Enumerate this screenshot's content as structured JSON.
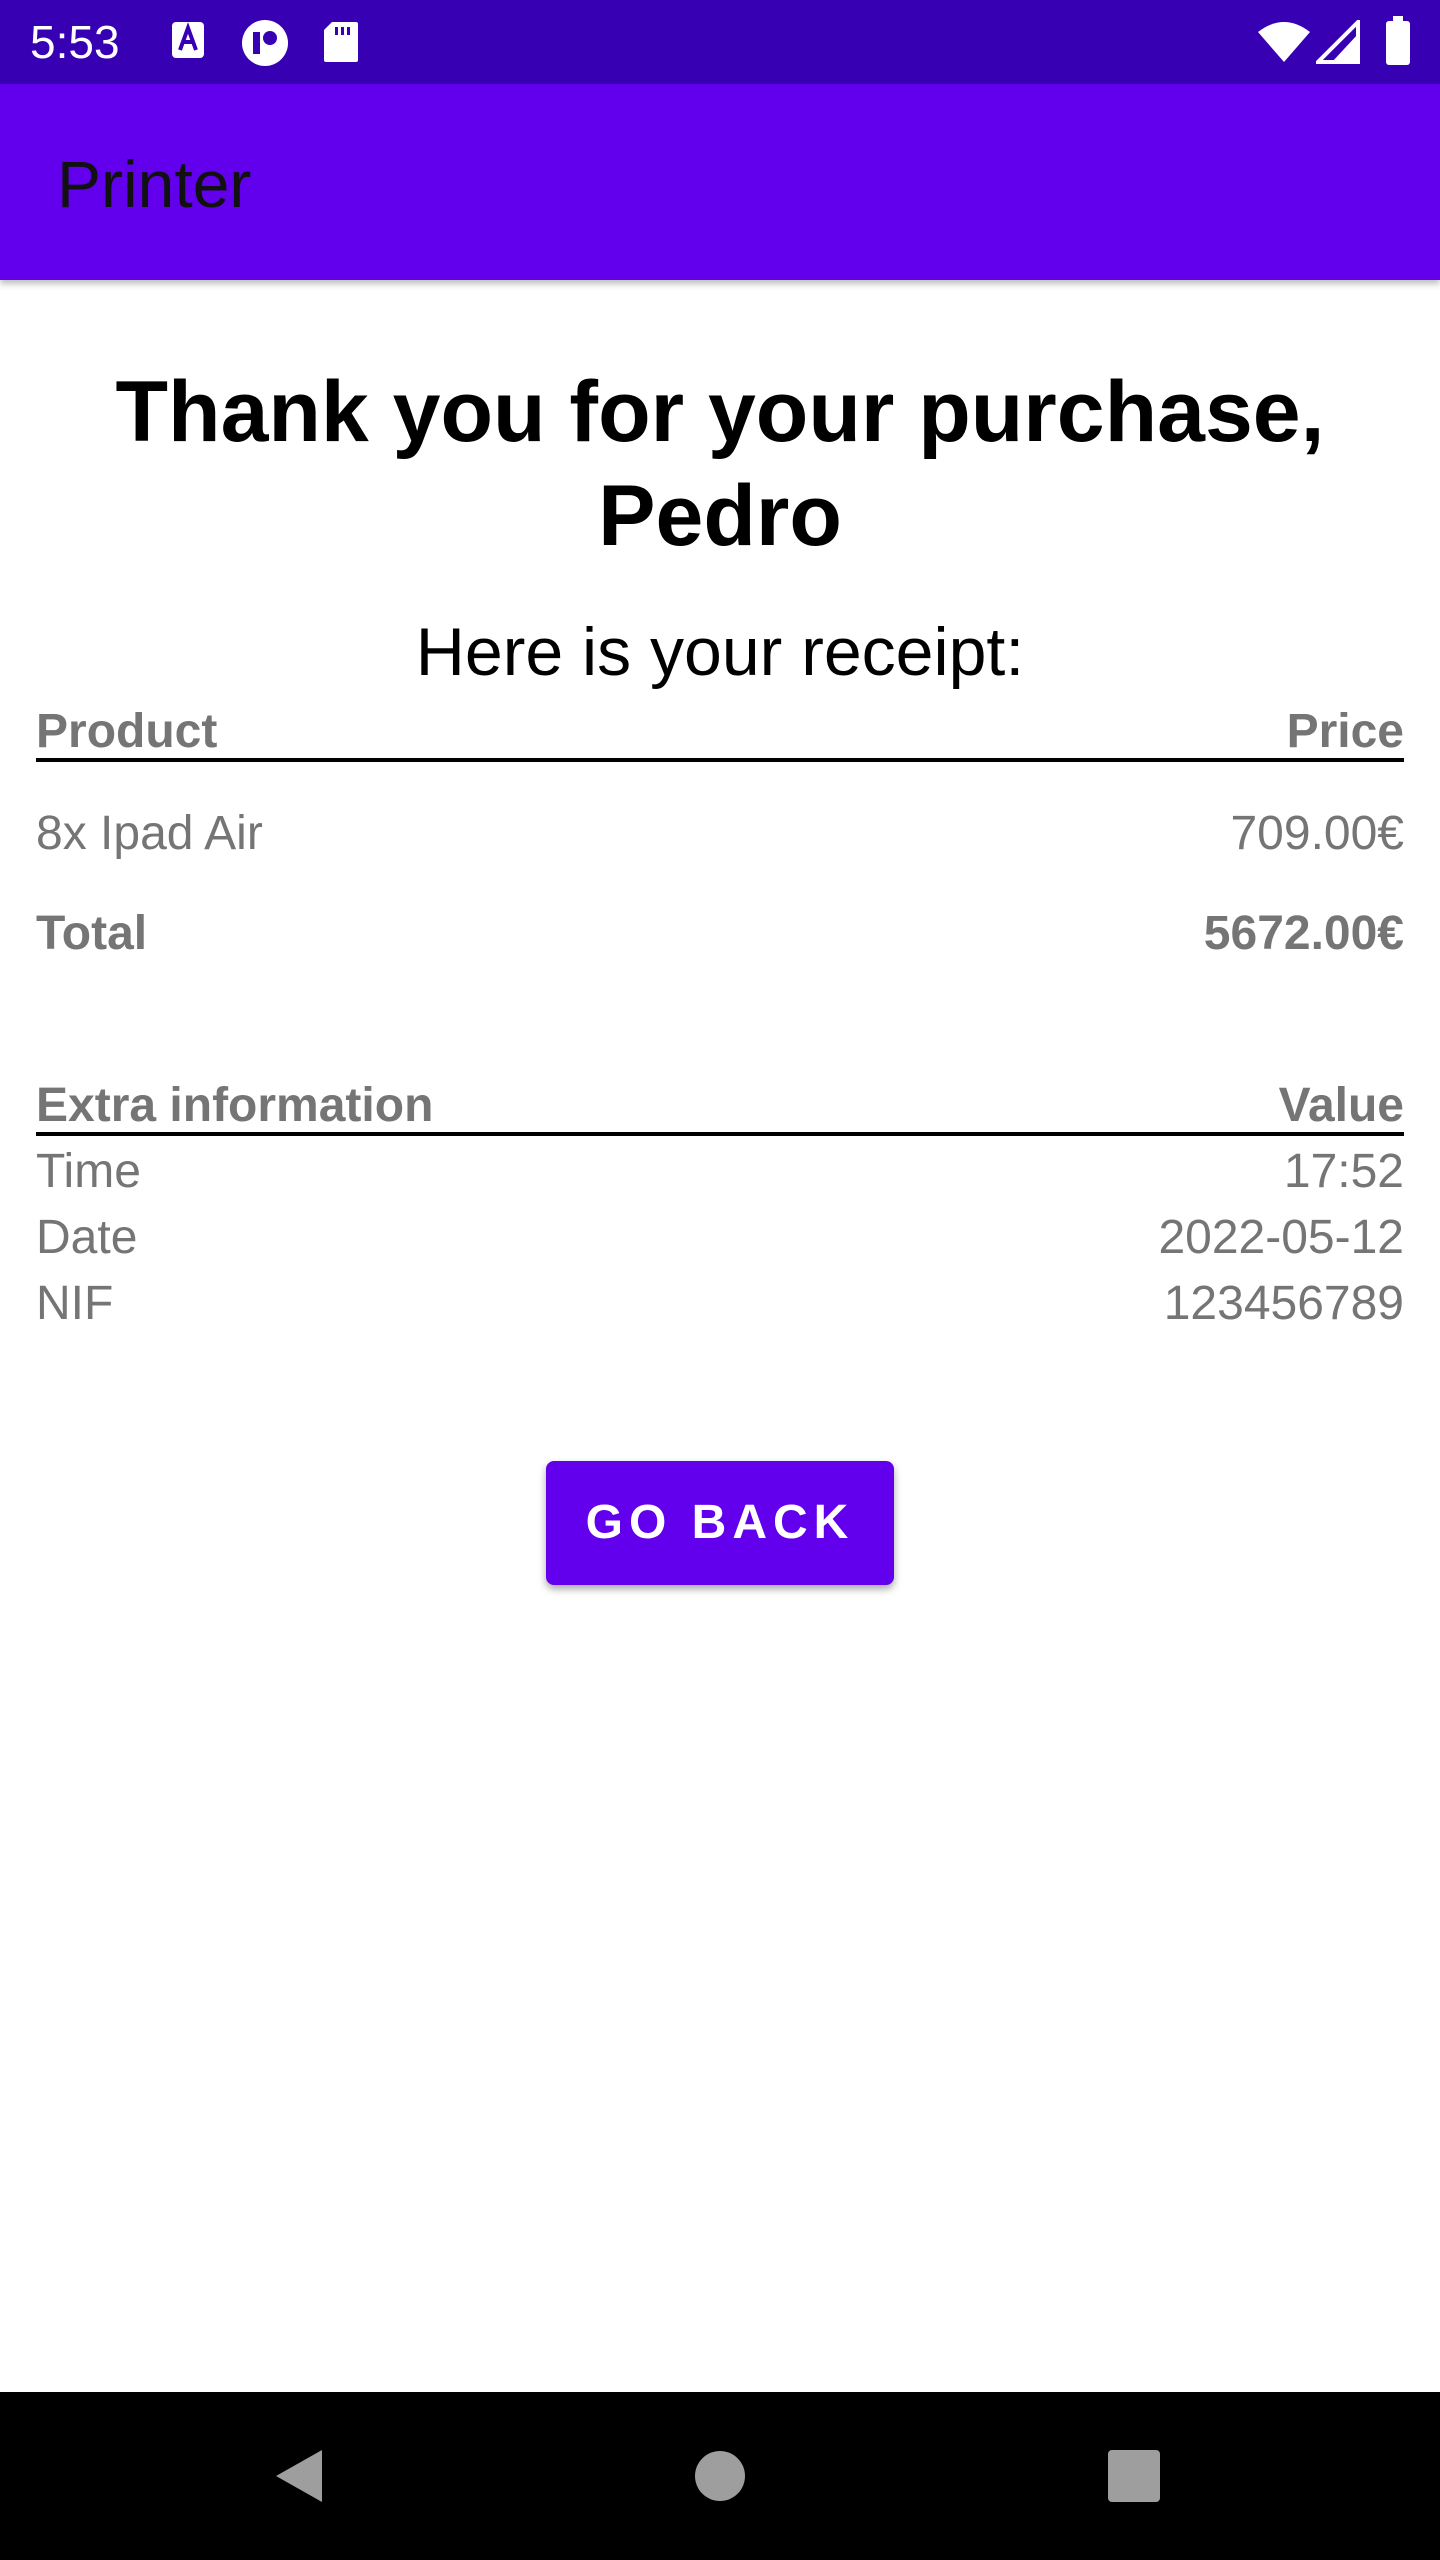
{
  "status_bar": {
    "time": "5:53",
    "icons_left": [
      "text-a-icon",
      "accessibility-icon",
      "sd-card-icon"
    ],
    "icons_right": [
      "wifi-icon",
      "signal-icon",
      "battery-icon"
    ]
  },
  "app_bar": {
    "title": "Printer"
  },
  "receipt": {
    "heading": "Thank you for your purchase, Pedro",
    "subheading": "Here is your receipt:",
    "products": {
      "headers": {
        "product": "Product",
        "price": "Price"
      },
      "rows": [
        {
          "product": "8x Ipad Air",
          "price": "709.00€"
        }
      ],
      "total": {
        "label": "Total",
        "value": "5672.00€"
      }
    },
    "extra": {
      "headers": {
        "name": "Extra information",
        "value": "Value"
      },
      "rows": [
        {
          "name": "Time",
          "value": "17:52"
        },
        {
          "name": "Date",
          "value": "2022-05-12"
        },
        {
          "name": "NIF",
          "value": "123456789"
        }
      ]
    }
  },
  "actions": {
    "go_back_label": "GO BACK"
  },
  "nav_bar": {
    "buttons": [
      "back-icon",
      "home-icon",
      "recents-icon"
    ]
  },
  "colors": {
    "status_bar": "#3700b3",
    "primary": "#6200ee",
    "secondary_text": "#757575"
  }
}
